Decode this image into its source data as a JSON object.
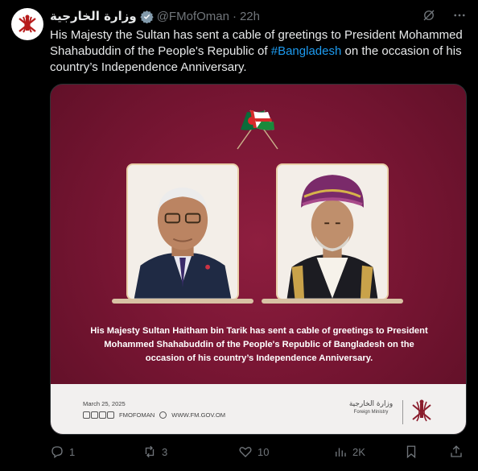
{
  "tweet": {
    "display_name": "وزارة الخارجية",
    "handle": "@FMofOman",
    "separator": "·",
    "time": "22h",
    "text": {
      "part1": "His Majesty the Sultan has sent a cable of greetings to President Mohammed Shahabuddin of the People's Republic of ",
      "hashtag": "#Bangladesh",
      "part2": " on the occasion of his country’s Independence Anniversary."
    }
  },
  "media": {
    "caption_line1": "His Majesty Sultan Haitham bin Tarik has sent a cable of greetings to President",
    "caption_line2": "Mohammed Shahabuddin of the People's Republic of Bangladesh on the",
    "caption_line3": "occasion of his country’s Independence Anniversary.",
    "date": "March 25, 2025",
    "social_handle": "FMOFOMAN",
    "website": "WWW.FM.GOV.OM",
    "ministry_ar": "وزارة الخارجية",
    "ministry_en": "Foreign Ministry"
  },
  "actions": {
    "replies": "1",
    "reposts": "3",
    "likes": "10",
    "views": "2K"
  },
  "colors": {
    "background": "#000000",
    "text": "#e7e9ea",
    "muted": "#71767b",
    "link": "#1d9bf0",
    "verified": "#829aab",
    "card_maroon": "#7a1634",
    "footer_bg": "#f2f0ef"
  },
  "icons": [
    "verified-badge-icon",
    "grok-icon",
    "more-icon",
    "reply-icon",
    "repost-icon",
    "like-icon",
    "views-icon",
    "bookmark-icon",
    "share-icon"
  ]
}
